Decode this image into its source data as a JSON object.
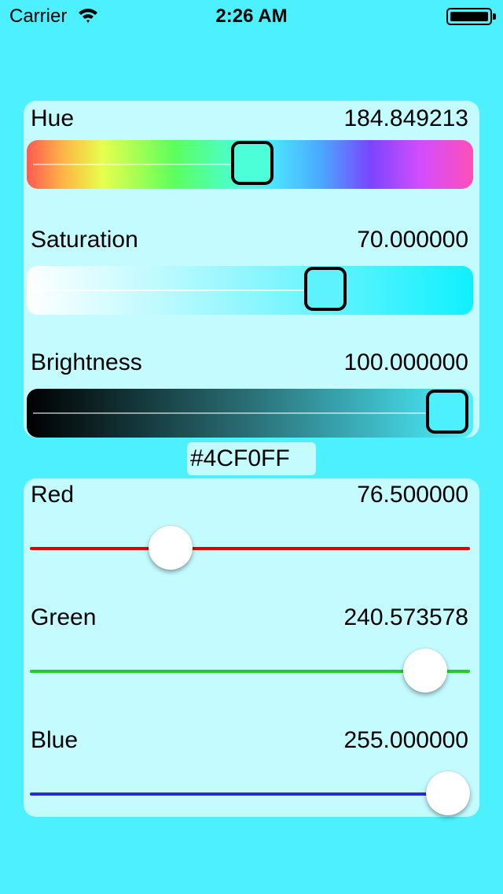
{
  "status_bar": {
    "carrier": "Carrier",
    "time": "2:26 AM"
  },
  "hsb": {
    "hue": {
      "label": "Hue",
      "value": "184.849213",
      "fraction": 0.513
    },
    "saturation": {
      "label": "Saturation",
      "value": "70.000000",
      "fraction": 0.7
    },
    "brightness": {
      "label": "Brightness",
      "value": "100.000000",
      "fraction": 1.0
    }
  },
  "hex": {
    "value": "#4CF0FF"
  },
  "rgb": {
    "red": {
      "label": "Red",
      "value": "76.500000",
      "fraction": 0.3,
      "color": "#E00000"
    },
    "green": {
      "label": "Green",
      "value": "240.573578",
      "fraction": 0.943,
      "color": "#1FD11F"
    },
    "blue": {
      "label": "Blue",
      "value": "255.000000",
      "fraction": 1.0,
      "color": "#2A2AD0"
    }
  },
  "colors": {
    "background": "#4CF0FF",
    "panel": "#C4FBFF"
  }
}
